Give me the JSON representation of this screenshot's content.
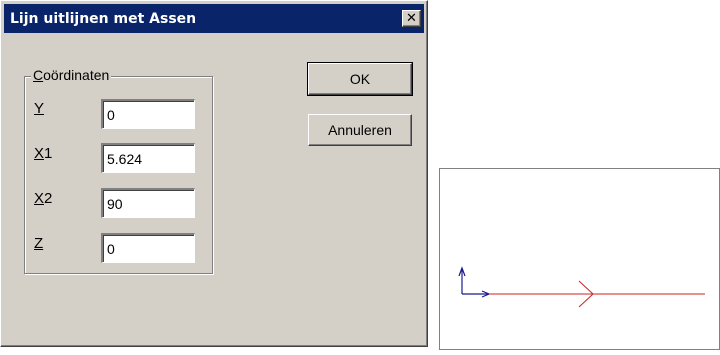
{
  "dialog": {
    "title": "Lijn uitlijnen met Assen",
    "close_symbol": "✕"
  },
  "group": {
    "label_mnemonic": "C",
    "label_rest": "oördinaten",
    "fields": [
      {
        "mnemonic": "Y",
        "suffix": "",
        "value": "0"
      },
      {
        "mnemonic": "X",
        "suffix": "1",
        "value": "5.624"
      },
      {
        "mnemonic": "X",
        "suffix": "2",
        "value": "90"
      },
      {
        "mnemonic": "Z",
        "suffix": "",
        "value": "0"
      }
    ]
  },
  "buttons": {
    "ok": "OK",
    "cancel": "Annuleren"
  },
  "preview": {
    "vertical_arrow_color": "#1a1a8c",
    "horizontal_arrow_color": "#1a1a8c",
    "line_color": "#d02020"
  }
}
